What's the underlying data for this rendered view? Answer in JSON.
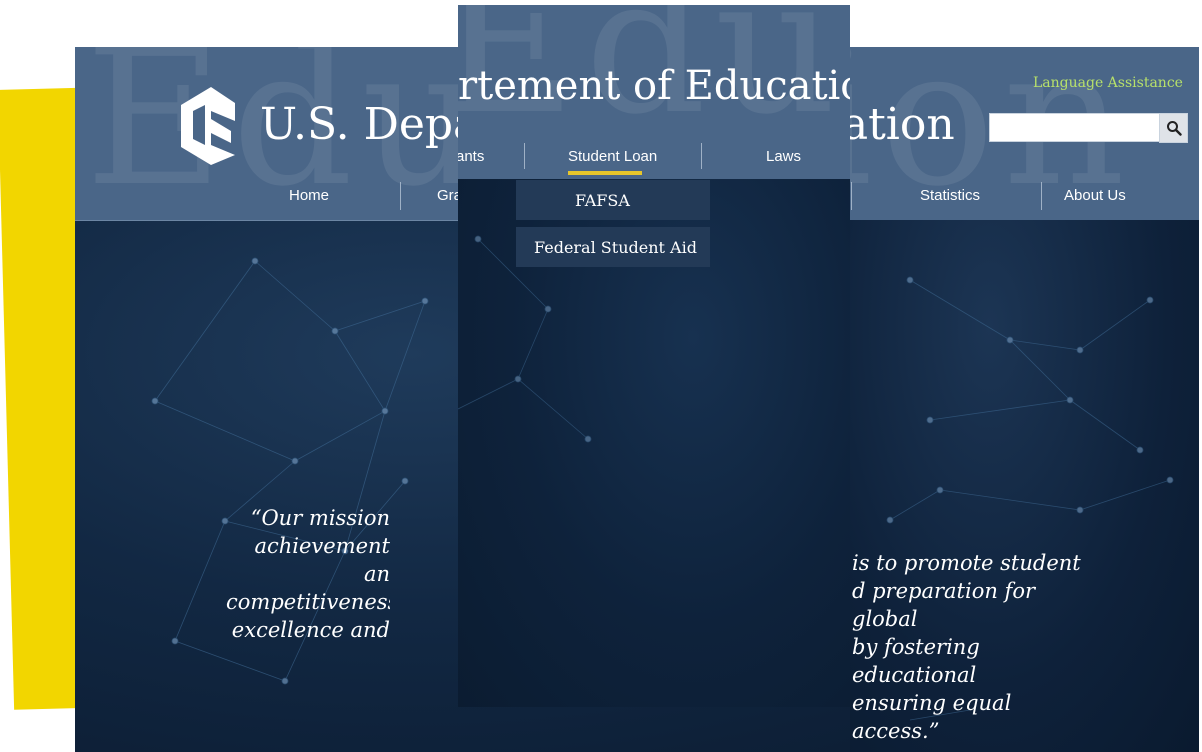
{
  "site": {
    "title_back": "U.S. Departement of Education",
    "title_front": "rtement of Education",
    "watermark": "Education",
    "language_assistance": "Language Assistance"
  },
  "search": {
    "placeholder": ""
  },
  "nav_back": [
    "Home",
    "Gra",
    "Statistics",
    "About Us"
  ],
  "nav_front": [
    "ants",
    "Student Loan",
    "Laws"
  ],
  "dropdown": [
    "FAFSA",
    "Federal Student Aid"
  ],
  "quote": {
    "left": "“Our mission\nachievement an\ncompetitiveness\nexcellence and",
    "right": "is to promote student\nd preparation for global\nby fostering educational\n ensuring equal access.”"
  },
  "colors": {
    "header": "#4a6688",
    "hero": "#0a1a2f",
    "accent_yellow": "#f2d600",
    "lang_green": "#b7e06a",
    "tab_underline": "#e7c62b"
  },
  "icons": [
    "logo-icon",
    "search-icon"
  ]
}
